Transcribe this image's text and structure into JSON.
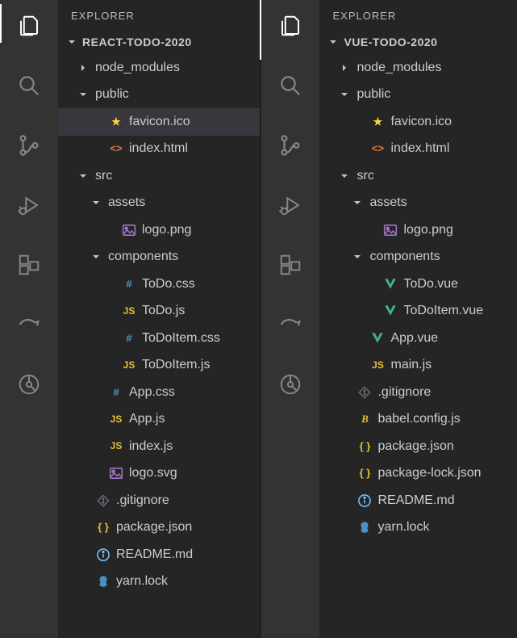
{
  "left": {
    "explorer_title": "EXPLORER",
    "project_name": "REACT-TODO-2020",
    "tree": [
      {
        "depth": 0,
        "kind": "folder",
        "expanded": false,
        "icon": "",
        "label": "node_modules"
      },
      {
        "depth": 0,
        "kind": "folder",
        "expanded": true,
        "icon": "",
        "label": "public"
      },
      {
        "depth": 1,
        "kind": "file",
        "icon": "star",
        "label": "favicon.ico",
        "selected": true
      },
      {
        "depth": 1,
        "kind": "file",
        "icon": "html",
        "label": "index.html"
      },
      {
        "depth": 0,
        "kind": "folder",
        "expanded": true,
        "icon": "",
        "label": "src"
      },
      {
        "depth": 1,
        "kind": "folder",
        "expanded": true,
        "icon": "",
        "label": "assets"
      },
      {
        "depth": 2,
        "kind": "file",
        "icon": "img",
        "label": "logo.png"
      },
      {
        "depth": 1,
        "kind": "folder",
        "expanded": true,
        "icon": "",
        "label": "components"
      },
      {
        "depth": 2,
        "kind": "file",
        "icon": "hash",
        "label": "ToDo.css"
      },
      {
        "depth": 2,
        "kind": "file",
        "icon": "js",
        "label": "ToDo.js"
      },
      {
        "depth": 2,
        "kind": "file",
        "icon": "hash",
        "label": "ToDoItem.css"
      },
      {
        "depth": 2,
        "kind": "file",
        "icon": "js",
        "label": "ToDoItem.js"
      },
      {
        "depth": 1,
        "kind": "file",
        "icon": "hash",
        "label": "App.css"
      },
      {
        "depth": 1,
        "kind": "file",
        "icon": "js",
        "label": "App.js"
      },
      {
        "depth": 1,
        "kind": "file",
        "icon": "js",
        "label": "index.js"
      },
      {
        "depth": 1,
        "kind": "file",
        "icon": "img",
        "label": "logo.svg"
      },
      {
        "depth": 0,
        "kind": "file",
        "icon": "git",
        "label": ".gitignore"
      },
      {
        "depth": 0,
        "kind": "file",
        "icon": "braces",
        "label": "package.json"
      },
      {
        "depth": 0,
        "kind": "file",
        "icon": "info",
        "label": "README.md"
      },
      {
        "depth": 0,
        "kind": "file",
        "icon": "yarn",
        "label": "yarn.lock"
      }
    ]
  },
  "right": {
    "explorer_title": "EXPLORER",
    "project_name": "VUE-TODO-2020",
    "tree": [
      {
        "depth": 0,
        "kind": "folder",
        "expanded": false,
        "icon": "",
        "label": "node_modules"
      },
      {
        "depth": 0,
        "kind": "folder",
        "expanded": true,
        "icon": "",
        "label": "public"
      },
      {
        "depth": 1,
        "kind": "file",
        "icon": "star",
        "label": "favicon.ico"
      },
      {
        "depth": 1,
        "kind": "file",
        "icon": "html",
        "label": "index.html"
      },
      {
        "depth": 0,
        "kind": "folder",
        "expanded": true,
        "icon": "",
        "label": "src"
      },
      {
        "depth": 1,
        "kind": "folder",
        "expanded": true,
        "icon": "",
        "label": "assets"
      },
      {
        "depth": 2,
        "kind": "file",
        "icon": "img",
        "label": "logo.png"
      },
      {
        "depth": 1,
        "kind": "folder",
        "expanded": true,
        "icon": "",
        "label": "components"
      },
      {
        "depth": 2,
        "kind": "file",
        "icon": "vue",
        "label": "ToDo.vue"
      },
      {
        "depth": 2,
        "kind": "file",
        "icon": "vue",
        "label": "ToDoItem.vue"
      },
      {
        "depth": 1,
        "kind": "file",
        "icon": "vue",
        "label": "App.vue"
      },
      {
        "depth": 1,
        "kind": "file",
        "icon": "js",
        "label": "main.js"
      },
      {
        "depth": 0,
        "kind": "file",
        "icon": "git",
        "label": ".gitignore"
      },
      {
        "depth": 0,
        "kind": "file",
        "icon": "babel",
        "label": "babel.config.js"
      },
      {
        "depth": 0,
        "kind": "file",
        "icon": "braces",
        "label": "package.json"
      },
      {
        "depth": 0,
        "kind": "file",
        "icon": "braces",
        "label": "package-lock.json"
      },
      {
        "depth": 0,
        "kind": "file",
        "icon": "info",
        "label": "README.md"
      },
      {
        "depth": 0,
        "kind": "file",
        "icon": "yarn",
        "label": "yarn.lock"
      }
    ]
  },
  "icons": {
    "star": "★",
    "html": "<>",
    "js": "JS",
    "hash": "#",
    "braces": "{ }",
    "babel": "B"
  }
}
